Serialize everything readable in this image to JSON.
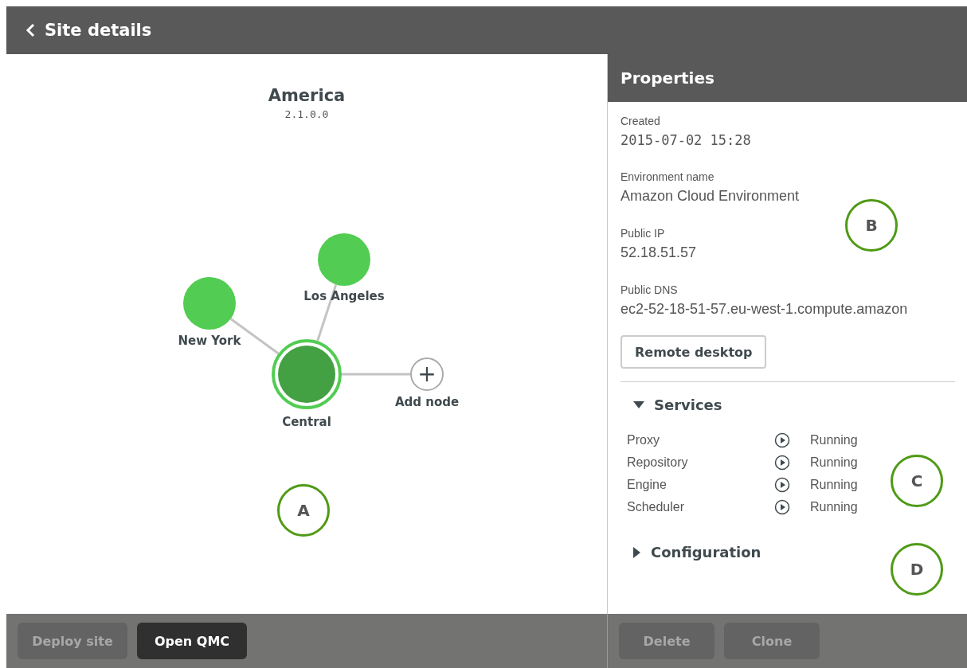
{
  "header": {
    "title": "Site details"
  },
  "site": {
    "name": "America",
    "version": "2.1.0.0"
  },
  "nodes": [
    {
      "kind": "central",
      "label": "Central"
    },
    {
      "kind": "site",
      "label": "New York"
    },
    {
      "kind": "site",
      "label": "Los Angeles"
    },
    {
      "kind": "add",
      "label": "Add node",
      "symbol": "+"
    }
  ],
  "left_buttons": [
    {
      "label": "Deploy site",
      "disabled": true
    },
    {
      "label": "Open QMC",
      "disabled": false
    }
  ],
  "properties": {
    "title": "Properties",
    "fields": [
      {
        "label": "Created",
        "value": "2015-07-02 15:28",
        "kind": "mono"
      },
      {
        "label": "Environment name",
        "value": "Amazon Cloud Environment",
        "kind": "text"
      },
      {
        "label": "Public IP",
        "value": "52.18.51.57",
        "kind": "text"
      },
      {
        "label": "Public DNS",
        "value": "ec2-52-18-51-57.eu-west-1.compute.amazon",
        "kind": "text"
      }
    ],
    "remote_button": "Remote desktop",
    "sections": [
      {
        "title": "Services",
        "expanded": true,
        "services": [
          {
            "name": "Proxy",
            "status": "Running"
          },
          {
            "name": "Repository",
            "status": "Running"
          },
          {
            "name": "Engine",
            "status": "Running"
          },
          {
            "name": "Scheduler",
            "status": "Running"
          }
        ]
      },
      {
        "title": "Configuration",
        "expanded": false
      }
    ]
  },
  "right_buttons": [
    {
      "label": "Delete",
      "disabled": true
    },
    {
      "label": "Clone",
      "disabled": true
    }
  ],
  "callouts": [
    "A",
    "B",
    "C",
    "D"
  ]
}
